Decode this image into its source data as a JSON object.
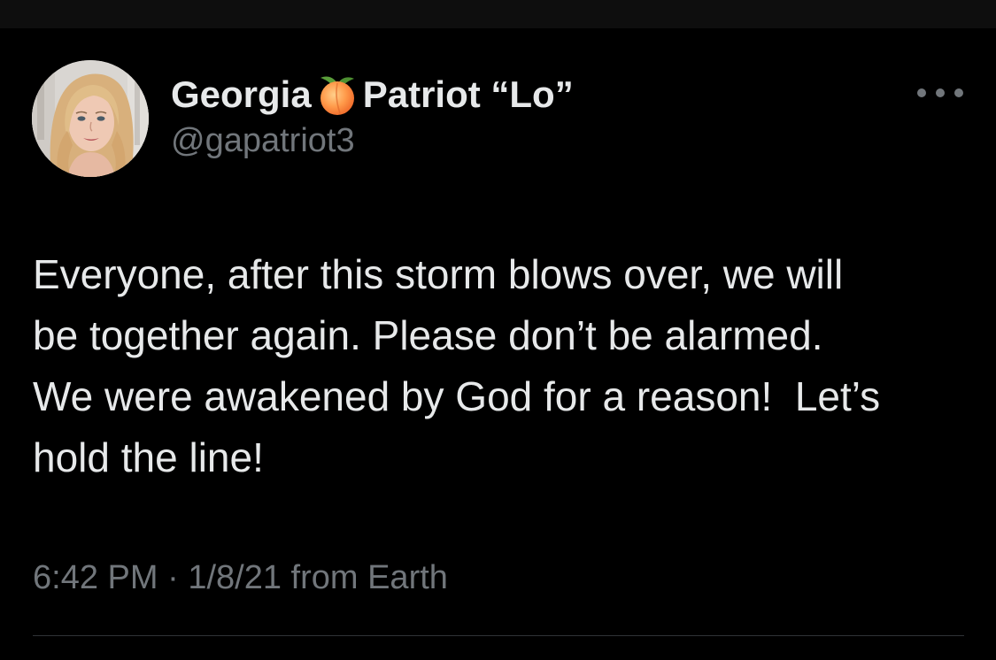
{
  "tweet": {
    "author": {
      "name_first": "Georgia",
      "name_emoji": "peach-emoji",
      "name_last": "Patriot “Lo”",
      "handle": "@gapatriot3"
    },
    "text_lines": [
      "Everyone, after this storm blows over, we will",
      "be together again. Please don’t be alarmed.",
      "We were awakened by God for a reason!  Let’s",
      "hold the line!"
    ],
    "meta": {
      "time": "6:42 PM",
      "separator": "·",
      "date": "1/8/21",
      "source": "from Earth"
    },
    "more_icon": "more-horizontal-icon"
  },
  "colors": {
    "background": "#000000",
    "primary_text": "#e7e9ea",
    "secondary_text": "#71767b",
    "divider": "#2f3336"
  }
}
